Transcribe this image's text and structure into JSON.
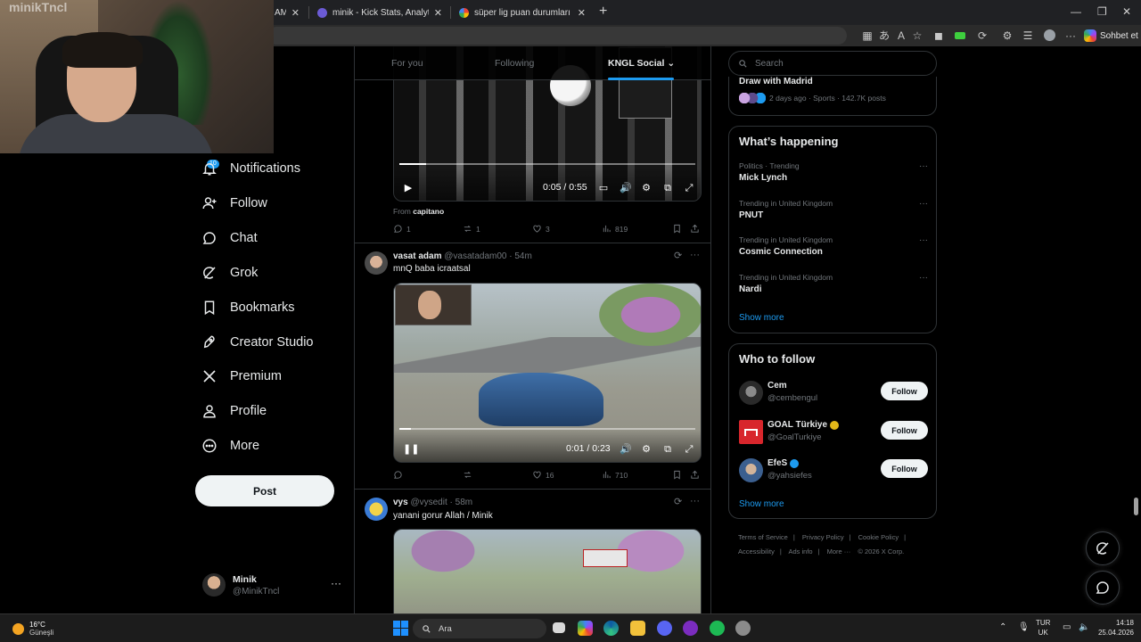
{
  "browser": {
    "tabs": [
      {
        "title": "AM / K",
        "color": "#1d9bf0"
      },
      {
        "title": "minik - Kick Stats, Analytics and C",
        "color": "#6b5bd6"
      },
      {
        "title": "süper lig puan durumları - Google",
        "color": "#ffffff"
      }
    ],
    "sohbet_label": "Sohbet et"
  },
  "webcam": {
    "watermark": "minikTncl"
  },
  "nav": {
    "notifications_badge": "10",
    "items": [
      {
        "label": "Notifications",
        "icon": "bell-icon"
      },
      {
        "label": "Follow",
        "icon": "person-add-icon"
      },
      {
        "label": "Chat",
        "icon": "chat-bubble-icon"
      },
      {
        "label": "Grok",
        "icon": "grok-icon"
      },
      {
        "label": "Bookmarks",
        "icon": "bookmark-icon"
      },
      {
        "label": "Creator Studio",
        "icon": "rocket-icon"
      },
      {
        "label": "Premium",
        "icon": "x-logo-icon"
      },
      {
        "label": "Profile",
        "icon": "person-icon"
      },
      {
        "label": "More",
        "icon": "more-circle-icon"
      }
    ],
    "post_label": "Post",
    "account": {
      "name": "Minik",
      "handle": "@MinikTncl",
      "more": "···"
    }
  },
  "feed": {
    "tabs": [
      "For you",
      "Following",
      "KNGL Social"
    ],
    "active_tab": "KNGL Social",
    "tweets": [
      {
        "video_time": "0:05 / 0:55",
        "from_prefix": "From",
        "from_user": "capitano",
        "stats": {
          "replies": "1",
          "reposts": "1",
          "likes": "3",
          "views": "819"
        },
        "progress": 0.09
      },
      {
        "name": "vasat adam",
        "handle": "@vasatadam00",
        "time": "54m",
        "text": "mnQ baba icraatsal",
        "video_time": "0:01 / 0:23",
        "stats": {
          "replies": "",
          "reposts": "",
          "likes": "16",
          "views": "710"
        },
        "progress": 0.04
      },
      {
        "name": "vys",
        "handle": "@vysedit",
        "time": "58m",
        "text": "yanani gorur Allah / Minik"
      }
    ]
  },
  "sidebar": {
    "search_placeholder": "Search",
    "top_trend": {
      "title": "Draw with Madrid",
      "meta": "2 days ago · Sports · 142.7K posts"
    },
    "happening_title": "What’s happening",
    "trends": [
      {
        "category": "Politics · Trending",
        "title": "Mick Lynch"
      },
      {
        "category": "Trending in United Kingdom",
        "title": "PNUT"
      },
      {
        "category": "Trending in United Kingdom",
        "title": "Cosmic Connection"
      },
      {
        "category": "Trending in United Kingdom",
        "title": "Nardi"
      }
    ],
    "show_more": "Show more",
    "who_title": "Who to follow",
    "who": [
      {
        "name": "Cem",
        "handle": "@cembengul",
        "verified": "",
        "follow": "Follow",
        "avatar_color": "#2a2a2a"
      },
      {
        "name": "GOAL Türkiye",
        "handle": "@GoalTurkiye",
        "verified": "gold",
        "follow": "Follow",
        "avatar_color": "#d8262c"
      },
      {
        "name": "EfeS",
        "handle": "@yahsiefes",
        "verified": "blue",
        "follow": "Follow",
        "avatar_color": "#3b5f8f"
      }
    ],
    "show_more_2": "Show more",
    "footer": [
      "Terms of Service",
      "|",
      "Privacy Policy",
      "|",
      "Cookie Policy",
      "|",
      "Accessibility",
      "|",
      "Ads info",
      "|",
      "More ···",
      "© 2026 X Corp."
    ]
  },
  "taskbar": {
    "weather_temp": "16°C",
    "weather_desc": "Güneşli",
    "search_label": "Ara",
    "lang_top": "TUR",
    "lang_bottom": "UK",
    "time": "14:18",
    "date": "25.04.2026"
  }
}
